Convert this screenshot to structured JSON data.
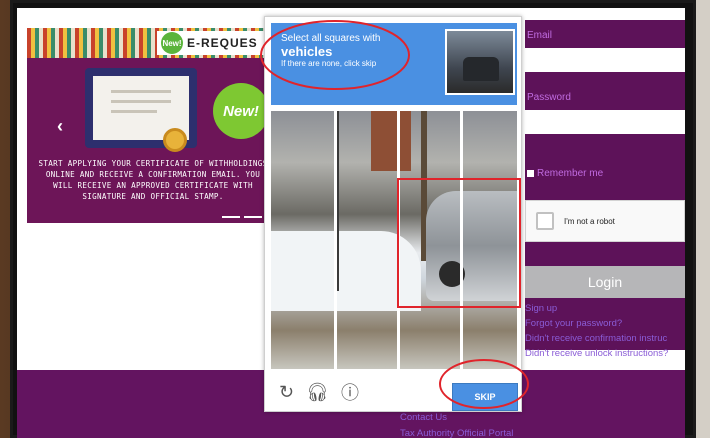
{
  "carousel": {
    "banner_new": "New!",
    "banner_title": "E-REQUES",
    "new_badge": "New!",
    "prev_arrow": "‹",
    "description": "START APPLYING YOUR CERTIFICATE OF WITHHOLDINGS ONLINE AND RECEIVE A CONFIRMATION EMAIL. YOU WILL RECEIVE AN APPROVED CERTIFICATE WITH SIGNATURE AND OFFICIAL STAMP."
  },
  "login": {
    "email_label": "Email",
    "password_label": "Password",
    "remember_label": "Remember me",
    "recaptcha_label": "I'm not a robot",
    "login_button": "Login",
    "links": [
      "Sign up",
      "Forgot your password?",
      "Didn't receive confirmation instruc",
      "Didn't receive unlock instructions?"
    ]
  },
  "captcha": {
    "instruction": "Select all squares with",
    "target": "vehicles",
    "hint": "If there are none, click skip",
    "skip_button": "SKIP",
    "reload_icon": "reload-icon",
    "audio_icon": "headphones-icon",
    "info_icon": "info-icon"
  },
  "footer": {
    "links": [
      "Contact Us",
      "Tax Authority Official Portal"
    ]
  },
  "colors": {
    "purple": "#5d1259",
    "link": "#8a5cd6",
    "captcha_blue": "#4a90e2",
    "annotation_red": "#e0242b"
  }
}
